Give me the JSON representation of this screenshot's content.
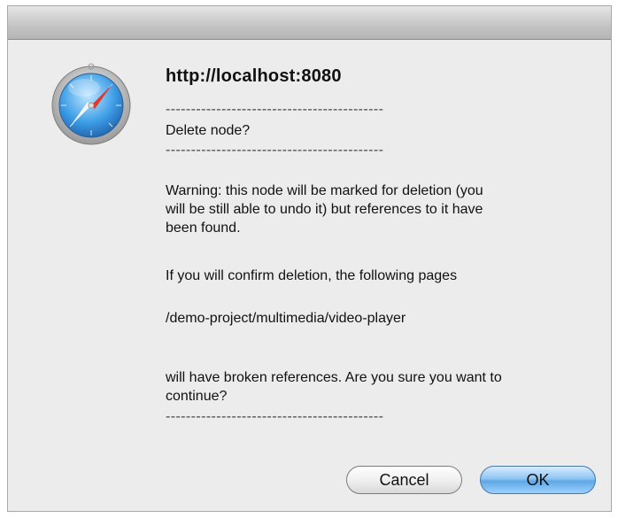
{
  "dialog": {
    "title": "http://localhost:8080",
    "app_icon": "safari-compass-icon",
    "separator_top": "-------------------------------------------",
    "question": "Delete node?",
    "separator_mid": "-------------------------------------------",
    "warning": "Warning: this node will be marked for deletion (you\nwill be still able to undo it) but references to it have\nbeen found.",
    "confirm_text": "If you will confirm deletion, the following pages",
    "page_path": "/demo-project/multimedia/video-player",
    "broken_refs": "will have broken references. Are you sure you want to\ncontinue?",
    "separator_bottom": "-------------------------------------------"
  },
  "buttons": {
    "cancel_label": "Cancel",
    "ok_label": "OK"
  },
  "colors": {
    "dialog_bg": "#ececec",
    "ok_blue": "#6fb1ea"
  }
}
